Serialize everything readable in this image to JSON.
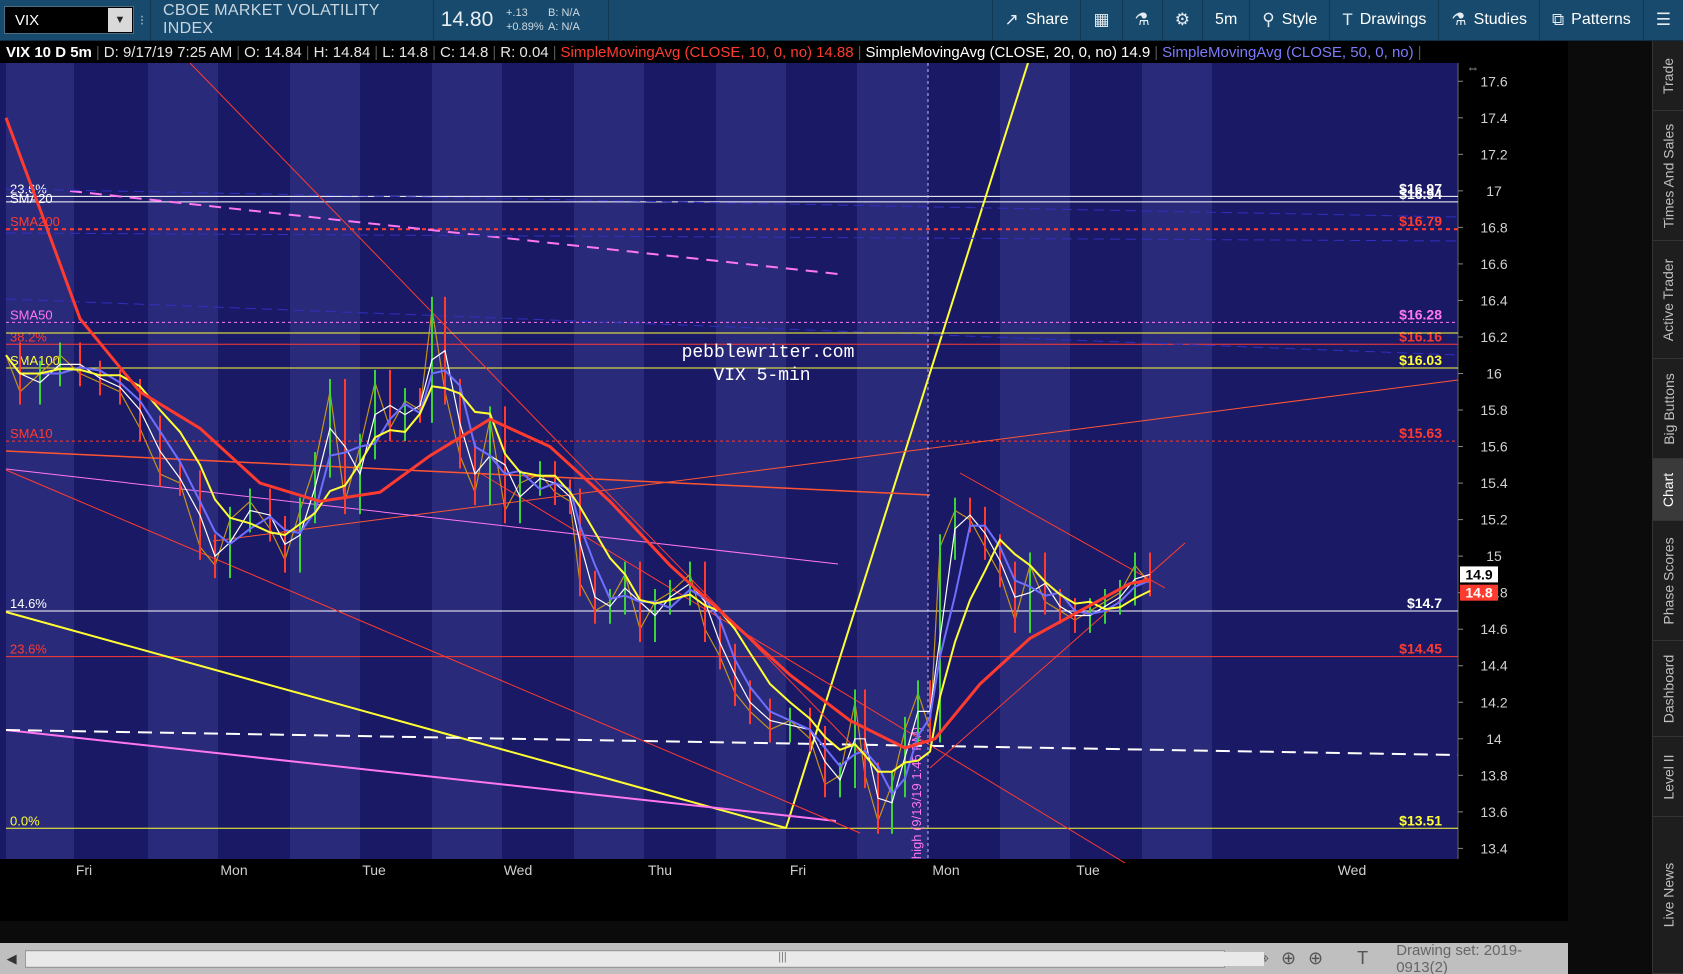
{
  "toolbar": {
    "symbol": "VIX",
    "description": "CBOE MARKET VOLATILITY INDEX",
    "price": "14.80",
    "change_abs": "+.13",
    "change_pct": "+0.89%",
    "bid": "B: N/A",
    "ask": "A: N/A",
    "share": "Share",
    "interval": "5m",
    "style": "Style",
    "drawings": "Drawings",
    "studies": "Studies",
    "patterns": "Patterns"
  },
  "header": {
    "symbol_info": "VIX 10 D 5m",
    "date": "D: 9/17/19 7:25 AM",
    "open": "O: 14.84",
    "high": "H: 14.84",
    "low": "L: 14.8",
    "close": "C: 14.8",
    "range": "R: 0.04",
    "sma10_label": "SimpleMovingAvg (CLOSE, 10, 0, no)",
    "sma10_value": "14.88",
    "sma20_label": "SimpleMovingAvg (CLOSE, 20, 0, no)",
    "sma20_value": "14.9",
    "sma50_label": "SimpleMovingAvg (CLOSE, 50, 0, no)",
    "sma50_value": ""
  },
  "chart_data": {
    "type": "candlestick",
    "yaxis_ticks": [
      "17.6",
      "17.4",
      "17.2",
      "17",
      "16.8",
      "16.6",
      "16.4",
      "16.2",
      "16",
      "15.8",
      "15.6",
      "15.4",
      "15.2",
      "15",
      "14.8",
      "14.6",
      "14.4",
      "14.2",
      "14",
      "13.8",
      "13.6",
      "13.4"
    ],
    "ylim": [
      13.32,
      17.7
    ],
    "day_labels": [
      "Fri",
      "Mon",
      "Tue",
      "Wed",
      "Thu",
      "Fri",
      "Mon",
      "Tue",
      "Wed"
    ],
    "price_tags": {
      "last": "14.9",
      "current": "14.8"
    },
    "watermark": [
      "pebblewriter.com",
      "VIX 5-min"
    ],
    "vertical_annotation": "high (9/13/19 1:45 PM)",
    "levels": [
      {
        "left_label": "23.6%",
        "right_label": "$16.97",
        "value": 16.97,
        "color": "#ffffff"
      },
      {
        "left_label": "SMA20",
        "right_label": "$16.94",
        "value": 16.94,
        "color": "#ffffff"
      },
      {
        "left_label": "SMA200",
        "right_label": "$16.79",
        "value": 16.79,
        "color": "#ff3b2f"
      },
      {
        "left_label": "SMA50",
        "right_label": "$16.28",
        "value": 16.28,
        "color": "#ff77ee"
      },
      {
        "left_label": "38.2%",
        "right_label": "$16.16",
        "value": 16.16,
        "color": "#ff3b2f"
      },
      {
        "left_label": "SMA100",
        "right_label": "$16.03",
        "value": 16.03,
        "color": "#ffff33"
      },
      {
        "left_label": "SMA10",
        "right_label": "$15.63",
        "value": 15.63,
        "color": "#ff3b2f"
      },
      {
        "left_label": "14.6%",
        "right_label": "$14.7",
        "value": 14.7,
        "color": "#ffffff"
      },
      {
        "left_label": "23.6%",
        "right_label": "$14.45",
        "value": 14.45,
        "color": "#ff3b2f"
      },
      {
        "left_label": "0.0%",
        "right_label": "$13.51",
        "value": 13.51,
        "color": "#ffff33"
      }
    ],
    "series": [
      {
        "name": "SimpleMovingAvg (CLOSE, 10, 0, no)",
        "color": "#ffffff"
      },
      {
        "name": "SimpleMovingAvg (CLOSE, 20, 0, no)",
        "color": "#6f6fff"
      },
      {
        "name": "SimpleMovingAvg (CLOSE, 50, 0, no)",
        "color": "#ffff33"
      }
    ]
  },
  "bottom_bar": {
    "drawing_set": "Drawing set: 2019-0913(2)"
  },
  "side_tabs": [
    "Trade",
    "Times And Sales",
    "Active Trader",
    "Big Buttons",
    "Chart",
    "Phase Scores",
    "Dashboard",
    "Level II",
    "Live News"
  ]
}
